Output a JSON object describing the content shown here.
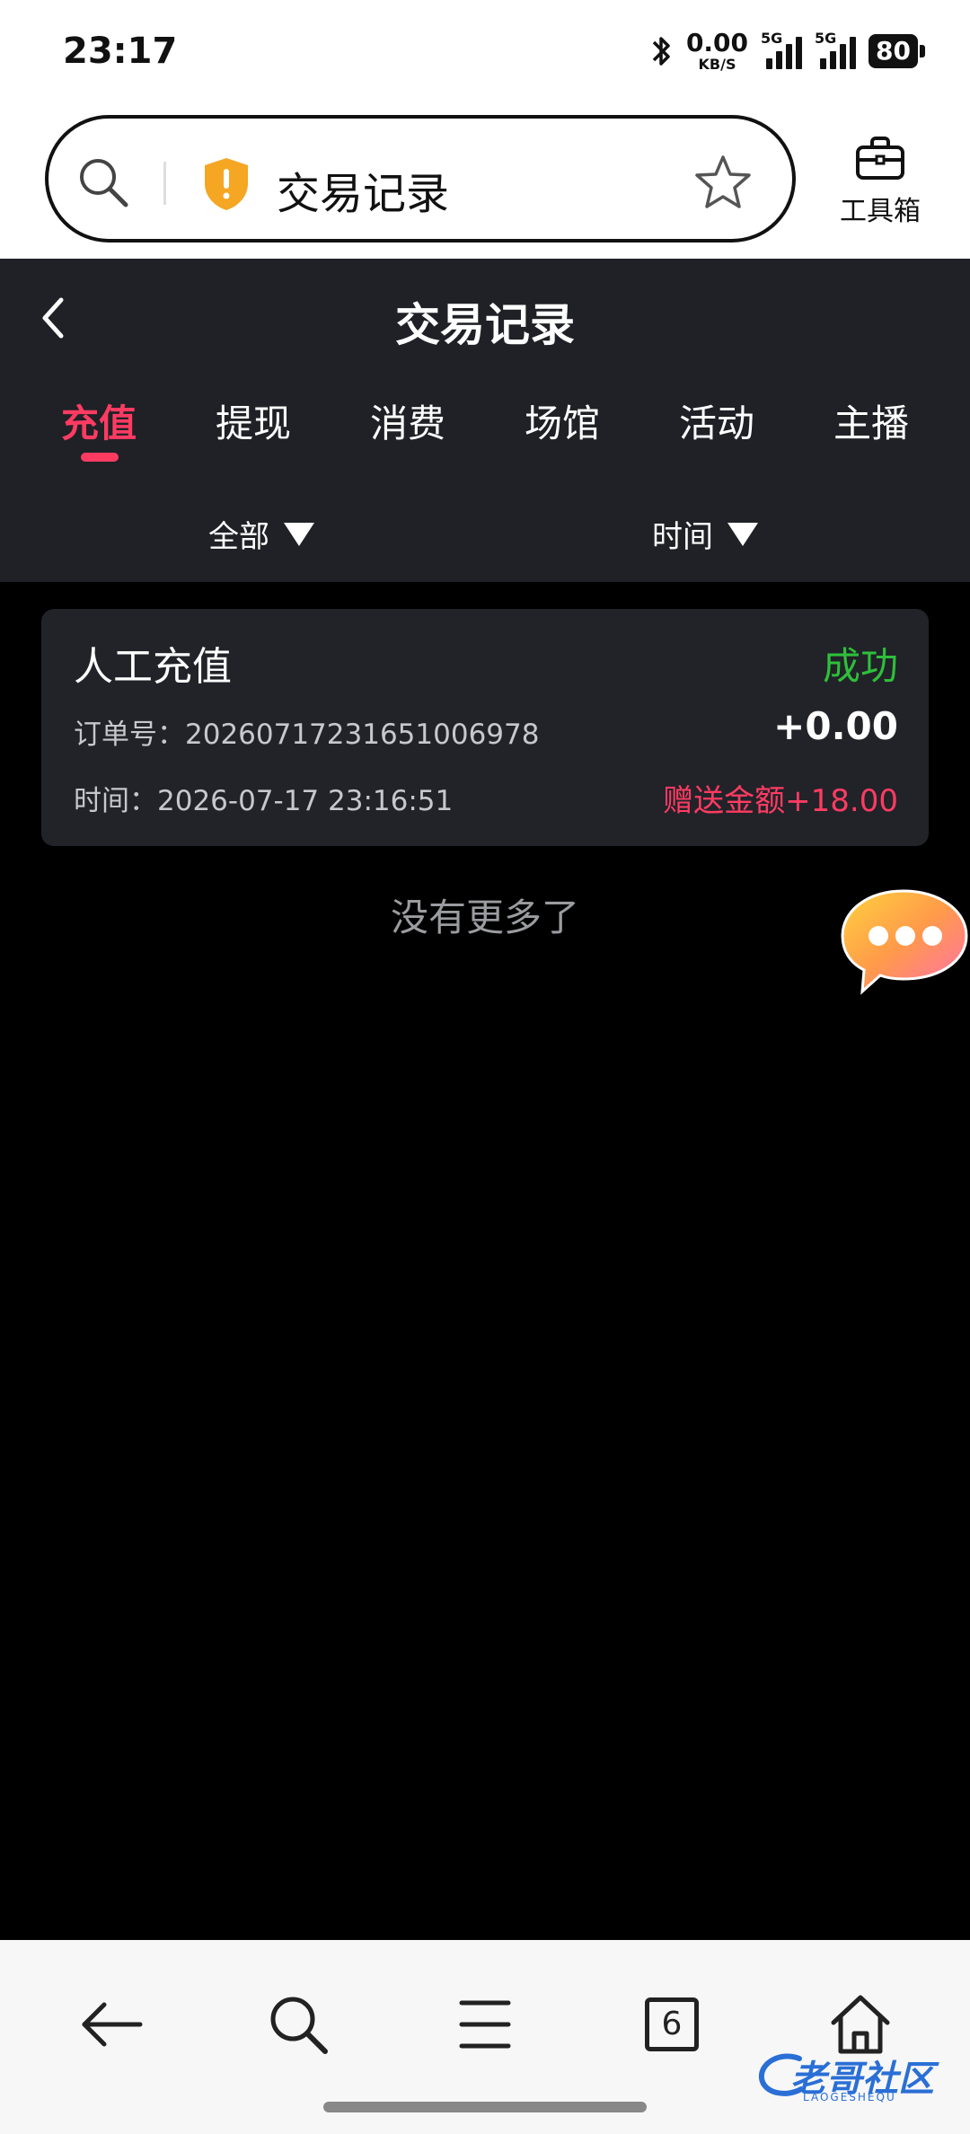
{
  "status_bar": {
    "time": "23:17",
    "net_speed_value": "0.00",
    "net_speed_unit": "KB/S",
    "sim1_tag": "5G",
    "sim2_tag": "5G",
    "battery": "80"
  },
  "browser": {
    "address_text": "交易记录",
    "toolbox_label": "工具箱"
  },
  "page": {
    "title": "交易记录",
    "tabs": [
      {
        "label": "充值",
        "active": true
      },
      {
        "label": "提现",
        "active": false
      },
      {
        "label": "消费",
        "active": false
      },
      {
        "label": "场馆",
        "active": false
      },
      {
        "label": "活动",
        "active": false
      },
      {
        "label": "主播",
        "active": false
      }
    ],
    "filters": {
      "type_label": "全部",
      "time_label": "时间"
    }
  },
  "records": [
    {
      "kind": "人工充值",
      "status": "成功",
      "order_label": "订单号：20260717231651006978",
      "amount": "+0.00",
      "time_label": "时间：2026-07-17 23:16:51",
      "bonus": "赠送金额+18.00"
    }
  ],
  "list_footer": "没有更多了",
  "bottom_nav": {
    "tabs_count": "6"
  },
  "watermark": {
    "text": "老哥社区",
    "sub": "LAOGESHEQU"
  },
  "colors": {
    "accent": "#ff3b62",
    "success": "#2fbf3a",
    "header_bg": "#1f2126",
    "card_bg": "#212329"
  }
}
